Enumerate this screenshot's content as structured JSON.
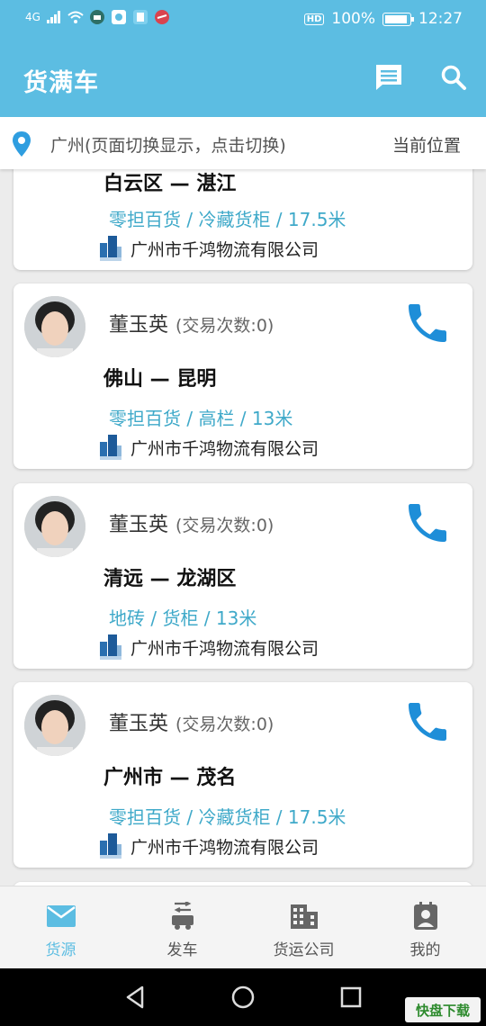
{
  "status_bar": {
    "network": "4G",
    "battery_text": "100%",
    "battery_level": 1.0,
    "hd_label": "HD",
    "time": "12:27"
  },
  "app_bar": {
    "title": "货满车",
    "message_icon": "message-icon",
    "search_icon": "search-icon"
  },
  "location_bar": {
    "text": "广州(页面切换显示，点击切换)",
    "current_location": "当前位置"
  },
  "cards": [
    {
      "route": "白云区 — 湛江",
      "cargo": "零担百货 / 冷藏货柜 / 17.5米",
      "company": "广州市千鸿物流有限公司"
    },
    {
      "name": "董玉英",
      "trade_count": "(交易次数:0)",
      "route": "佛山 — 昆明",
      "cargo": "零担百货 / 高栏 / 13米",
      "company": "广州市千鸿物流有限公司"
    },
    {
      "name": "董玉英",
      "trade_count": "(交易次数:0)",
      "route": "清远 — 龙湖区",
      "cargo": "地砖 / 货柜 / 13米",
      "company": "广州市千鸿物流有限公司"
    },
    {
      "name": "董玉英",
      "trade_count": "(交易次数:0)",
      "route": "广州市 — 茂名",
      "cargo": "零担百货 / 冷藏货柜 / 17.5米",
      "company": "广州市千鸿物流有限公司"
    }
  ],
  "bottom_nav": [
    {
      "label": "货源",
      "icon": "mail-icon",
      "active": true
    },
    {
      "label": "发车",
      "icon": "truck-icon",
      "active": false
    },
    {
      "label": "货运公司",
      "icon": "building-icon",
      "active": false
    },
    {
      "label": "我的",
      "icon": "profile-icon",
      "active": false
    }
  ],
  "watermark": {
    "text": "快盘下载"
  },
  "colors": {
    "primary": "#5cbde2",
    "cargo_text": "#3fa9c9",
    "phone": "#1e8ed8",
    "company_icon": "#2a6fb0"
  }
}
